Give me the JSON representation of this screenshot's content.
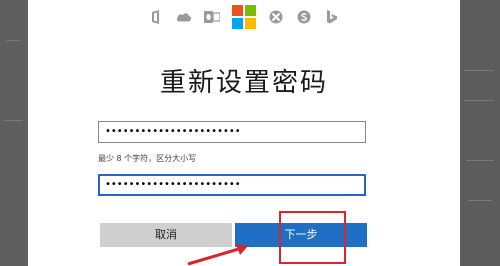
{
  "header_icons": [
    "office-icon",
    "onedrive-icon",
    "outlook-icon",
    "microsoft-logo",
    "xbox-icon",
    "skype-icon",
    "bing-icon"
  ],
  "colors": {
    "ms_red": "#f25022",
    "ms_green": "#7fba00",
    "ms_blue": "#00a4ef",
    "ms_yellow": "#ffb900",
    "primary_button": "#1f6fc5",
    "highlight_red": "#d8262a"
  },
  "page": {
    "title": "重新设置密码"
  },
  "form": {
    "new_password_value": "•••••••••••••••••••••••",
    "hint": "最少 8 个字符，区分大小写",
    "confirm_password_value": "•••••••••••••••••••••••"
  },
  "buttons": {
    "cancel_label": "取消",
    "next_label": "下一步"
  }
}
